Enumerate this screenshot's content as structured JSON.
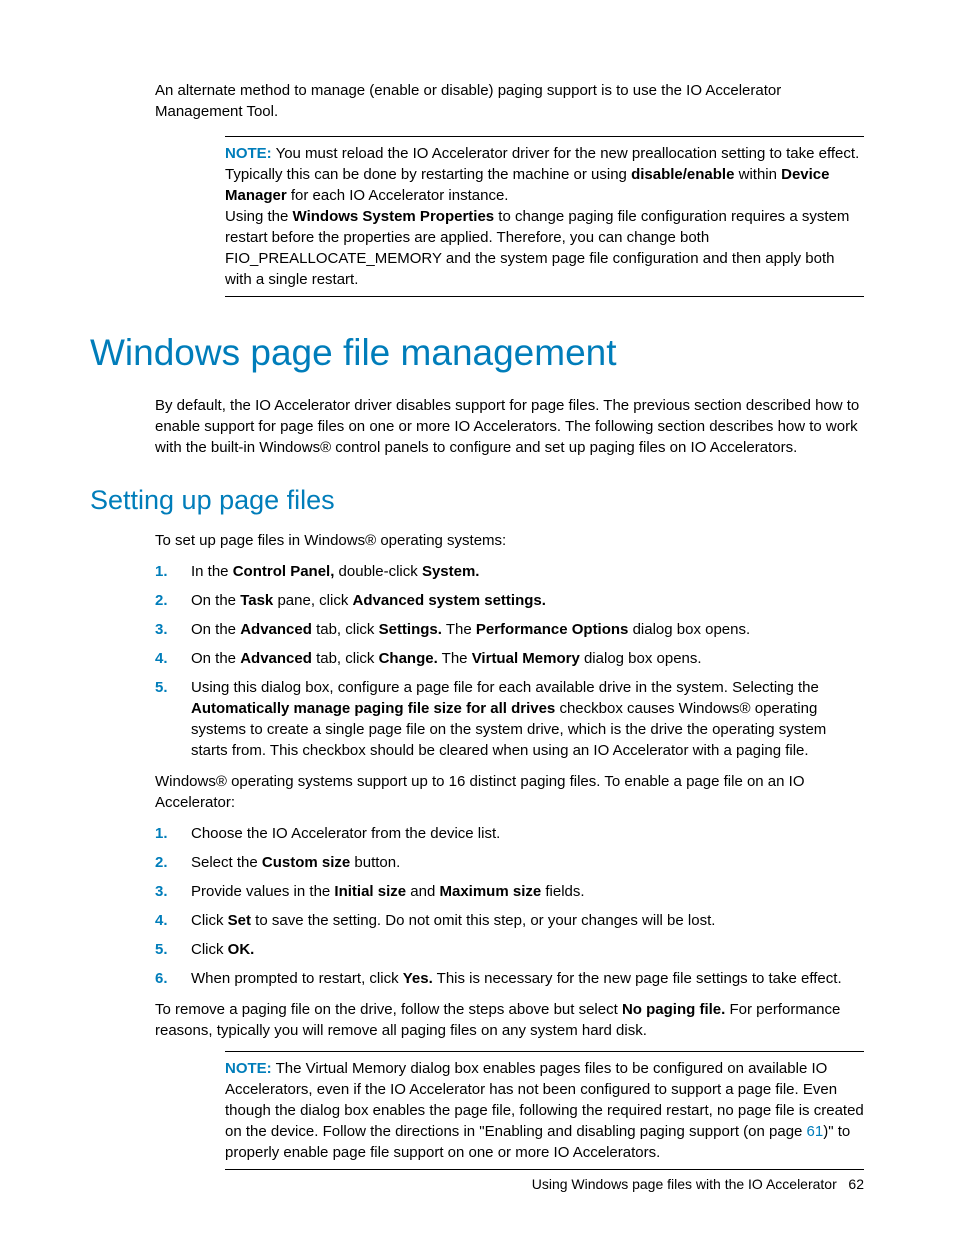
{
  "intro": "An alternate method to manage (enable or disable) paging support is to use the IO Accelerator Management Tool.",
  "note1": {
    "label": "NOTE:",
    "p1_a": "You must reload the IO Accelerator driver for the new preallocation setting to take effect. Typically this can be done by restarting the machine or using ",
    "p1_b1": "disable/enable",
    "p1_c": " within ",
    "p1_b2": "Device Manager",
    "p1_d": " for each IO Accelerator instance.",
    "p2_a": "Using the ",
    "p2_b1": "Windows System Properties",
    "p2_c": " to change paging file configuration requires a system restart before the properties are applied. Therefore, you can change both FIO_PREALLOCATE_MEMORY and the system page file configuration and then apply both with a single restart."
  },
  "h1": "Windows page file management",
  "h1_body": "By default, the IO Accelerator driver disables support for page files. The previous section described how to enable support for page files on one or more IO Accelerators. The following section describes how to work with the built-in Windows® control panels to configure and set up paging files on IO Accelerators.",
  "h2": "Setting up page files",
  "h2_intro": "To set up page files in Windows® operating systems:",
  "listA": {
    "s1": {
      "a": "In the ",
      "b1": "Control Panel,",
      "c": " double-click ",
      "b2": "System."
    },
    "s2": {
      "a": "On the ",
      "b1": "Task",
      "c": " pane, click ",
      "b2": "Advanced system settings."
    },
    "s3": {
      "a": "On the ",
      "b1": "Advanced",
      "c": " tab, click ",
      "b2": "Settings.",
      "d": " The ",
      "b3": "Performance Options",
      "e": " dialog box opens."
    },
    "s4": {
      "a": "On the ",
      "b1": "Advanced",
      "c": " tab, click ",
      "b2": "Change.",
      "d": " The ",
      "b3": "Virtual Memory",
      "e": " dialog box opens."
    },
    "s5": {
      "a": "Using this dialog box, configure a page file for each available drive in the system. Selecting the ",
      "b1": "Automatically manage paging file size for all drives",
      "c": " checkbox causes Windows® operating systems to create a single page file on the system drive, which is the drive the operating system starts from. This checkbox should be cleared when using an IO Accelerator with a paging file."
    }
  },
  "mid_para": "Windows® operating systems support up to 16 distinct paging files. To enable a page file on an IO Accelerator:",
  "listB": {
    "s1": {
      "a": "Choose the IO Accelerator from the device list."
    },
    "s2": {
      "a": "Select the ",
      "b1": "Custom size",
      "c": " button."
    },
    "s3": {
      "a": "Provide values in the ",
      "b1": "Initial size",
      "c": " and ",
      "b2": "Maximum size",
      "d": " fields."
    },
    "s4": {
      "a": "Click ",
      "b1": "Set",
      "c": " to save the setting. Do not omit this step, or your changes will be lost."
    },
    "s5": {
      "a": "Click ",
      "b1": "OK."
    },
    "s6": {
      "a": "When prompted to restart, click ",
      "b1": "Yes.",
      "c": " This is necessary for the new page file settings to take effect."
    }
  },
  "remove_para": {
    "a": "To remove a paging file on the drive, follow the steps above but select ",
    "b1": "No paging file.",
    "c": " For performance reasons, typically you will remove all paging files on any system hard disk."
  },
  "note2": {
    "label": "NOTE:",
    "a": "The Virtual Memory dialog box enables pages files to be configured on available IO Accelerators, even if the IO Accelerator has not been configured to support a page file. Even though the dialog box enables the page file, following the required restart, no page file is created on the device. Follow the directions in \"Enabling and disabling paging support (on page ",
    "link": "61",
    "b": ")\" to properly enable page file support on one or more IO Accelerators."
  },
  "footer": {
    "text": "Using Windows page files with the IO Accelerator",
    "page": "62"
  }
}
